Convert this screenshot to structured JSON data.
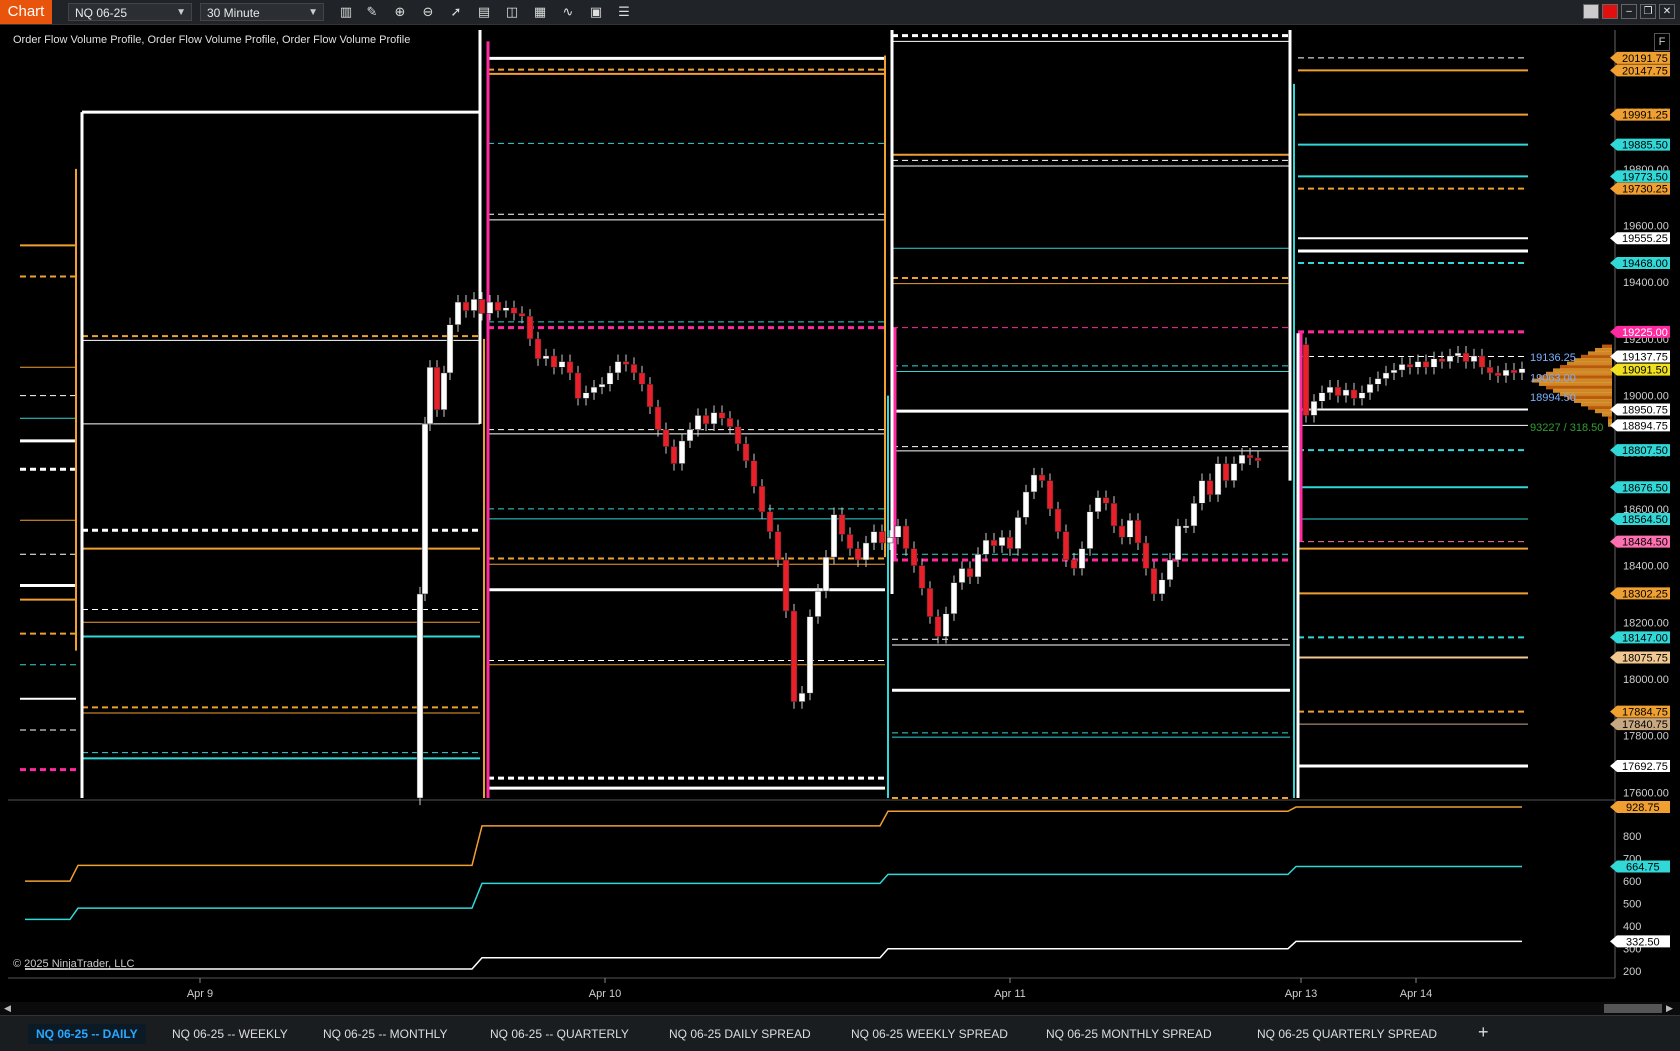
{
  "app": {
    "badge": "Chart",
    "instrument": "NQ 06-25",
    "interval": "30 Minute",
    "indicator_label": "Order Flow Volume Profile, Order Flow Volume Profile, Order Flow Volume Profile",
    "copyright": "© 2025 NinjaTrader, LLC",
    "corner_button": "F"
  },
  "toolbar_icons": [
    "bar-type-icon",
    "drawing-pencil-icon",
    "zoom-in-icon",
    "zoom-out-icon",
    "pointer-icon",
    "data-box-icon",
    "split-icon",
    "templates-icon",
    "indicators-icon",
    "strategies-icon",
    "properties-list-icon"
  ],
  "tabs": [
    {
      "label": "NQ 06-25 -- DAILY",
      "active": true
    },
    {
      "label": "NQ 06-25 -- WEEKLY",
      "active": false
    },
    {
      "label": "NQ 06-25 -- MONTHLY",
      "active": false
    },
    {
      "label": "NQ 06-25 -- QUARTERLY",
      "active": false
    },
    {
      "label": "NQ 06-25 DAILY SPREAD",
      "active": false
    },
    {
      "label": "NQ 06-25 WEEKLY SPREAD",
      "active": false
    },
    {
      "label": "NQ 06-25 MONTHLY SPREAD",
      "active": false
    },
    {
      "label": "NQ 06-25 QUARTERLY SPREAD",
      "active": false
    }
  ],
  "tab_add": "+",
  "colors": {
    "orange": "#f0a030",
    "cyan": "#30d8d8",
    "white": "#ffffff",
    "magenta": "#ff2aa0",
    "up": "#ffffff",
    "down": "#e8202a",
    "axis": "#888888"
  },
  "chart_data": {
    "type": "candlestick",
    "x_ticks": [
      "Apr 9",
      "Apr 10",
      "Apr 11",
      "Apr 13",
      "Apr 14"
    ],
    "y_ticks": [
      20000,
      19800,
      19600,
      19400,
      19200,
      19000,
      18800,
      18600,
      18400,
      18200,
      18000,
      17800,
      17600
    ],
    "ylim": [
      17580,
      20290
    ],
    "price_badges": [
      {
        "label": "20191.75",
        "value": 20191.75,
        "color": "#f0a030",
        "text": "#000"
      },
      {
        "label": "20147.75",
        "value": 20147.75,
        "color": "#f0a030",
        "text": "#000"
      },
      {
        "label": "19991.25",
        "value": 19991.25,
        "color": "#f0a030",
        "text": "#000"
      },
      {
        "label": "19885.50",
        "value": 19885.5,
        "color": "#30d8d8",
        "text": "#000"
      },
      {
        "label": "19773.50",
        "value": 19773.5,
        "color": "#30d8d8",
        "text": "#000"
      },
      {
        "label": "19730.25",
        "value": 19730.25,
        "color": "#f0a030",
        "text": "#000"
      },
      {
        "label": "19555.25",
        "value": 19555.25,
        "color": "#ffffff",
        "text": "#000"
      },
      {
        "label": "19468.00",
        "value": 19468.0,
        "color": "#30d8d8",
        "text": "#000"
      },
      {
        "label": "19225.00",
        "value": 19225.0,
        "color": "#ff2aa0",
        "text": "#fff"
      },
      {
        "label": "19137.75",
        "value": 19137.75,
        "color": "#ffffff",
        "text": "#000"
      },
      {
        "label": "19091.50",
        "value": 19091.5,
        "color": "#f0e020",
        "text": "#000"
      },
      {
        "label": "18950.75",
        "value": 18950.75,
        "color": "#ffffff",
        "text": "#000"
      },
      {
        "label": "18894.75",
        "value": 18894.75,
        "color": "#ffffff",
        "text": "#000"
      },
      {
        "label": "18807.50",
        "value": 18807.5,
        "color": "#30d8d8",
        "text": "#000"
      },
      {
        "label": "18676.50",
        "value": 18676.5,
        "color": "#30d8d8",
        "text": "#000"
      },
      {
        "label": "18564.50",
        "value": 18564.5,
        "color": "#30d8d8",
        "text": "#000"
      },
      {
        "label": "18484.50",
        "value": 18484.5,
        "color": "#ff70b0",
        "text": "#000"
      },
      {
        "label": "18302.25",
        "value": 18302.25,
        "color": "#f0a030",
        "text": "#000"
      },
      {
        "label": "18147.00",
        "value": 18147.0,
        "color": "#30d8d8",
        "text": "#000"
      },
      {
        "label": "18075.75",
        "value": 18075.75,
        "color": "#f0c890",
        "text": "#000"
      },
      {
        "label": "17884.75",
        "value": 17884.75,
        "color": "#f0a030",
        "text": "#000"
      },
      {
        "label": "17840.75",
        "value": 17840.75,
        "color": "#c8a880",
        "text": "#000"
      },
      {
        "label": "17692.75",
        "value": 17692.75,
        "color": "#ffffff",
        "text": "#000"
      }
    ],
    "profile_labels": [
      {
        "text": "19136.25",
        "value": 19136
      },
      {
        "text": "19063.00",
        "value": 19063
      },
      {
        "text": "18994.50",
        "value": 18994.5
      },
      {
        "text": "93227 / 318.50",
        "value": 18890
      }
    ],
    "sub_panel": {
      "y_ticks": [
        800,
        700,
        600,
        500,
        400,
        300,
        200
      ],
      "ylim": [
        170,
        960
      ],
      "badges": [
        {
          "label": "928.75",
          "value": 928.75,
          "color": "#f0a030"
        },
        {
          "label": "664.75",
          "value": 664.75,
          "color": "#30d8d8"
        },
        {
          "label": "332.50",
          "value": 332.5,
          "color": "#ffffff"
        }
      ]
    }
  }
}
